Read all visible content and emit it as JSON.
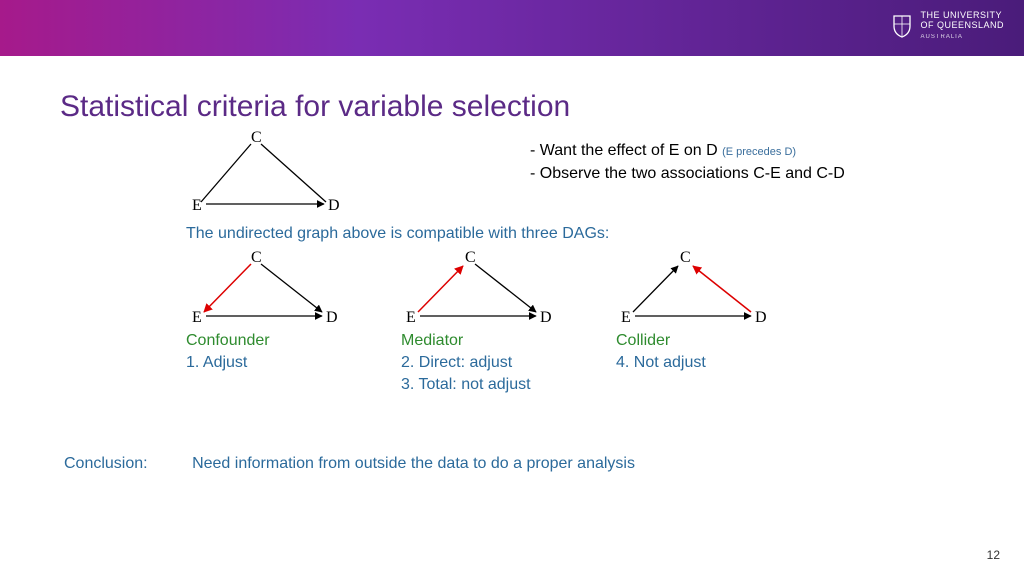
{
  "logo": {
    "line1": "THE UNIVERSITY",
    "line2": "OF QUEENSLAND",
    "sub": "AUSTRALIA"
  },
  "title": "Statistical criteria for variable selection",
  "notes": {
    "line1_prefix": "- Want the effect of E on D ",
    "line1_small": "(E precedes D)",
    "line2": "- Observe the two associations C-E and C-D"
  },
  "caption": "The undirected graph above is compatible with three DAGs:",
  "graph_nodes": {
    "c": "C",
    "e": "E",
    "d": "D"
  },
  "dags": [
    {
      "title": "Confounder",
      "actions": [
        "1. Adjust"
      ]
    },
    {
      "title": "Mediator",
      "actions": [
        "2. Direct: adjust",
        "3. Total: not adjust"
      ]
    },
    {
      "title": "Collider",
      "actions": [
        "4. Not adjust"
      ]
    }
  ],
  "conclusion": {
    "label": "Conclusion:",
    "text": "Need information from outside the data to do a proper analysis"
  },
  "page_number": "12"
}
